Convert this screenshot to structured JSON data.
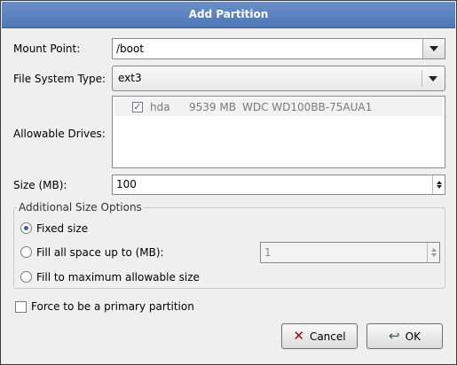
{
  "dialog": {
    "title": "Add Partition"
  },
  "mount_point": {
    "label": "Mount Point:",
    "value": "/boot"
  },
  "fs_type": {
    "label": "File System Type:",
    "value": "ext3"
  },
  "drives": {
    "label": "Allowable Drives:",
    "rows": [
      {
        "checked": true,
        "name": "hda",
        "size": "9539 MB",
        "model": "WDC WD100BB-75AUA1"
      }
    ]
  },
  "size": {
    "label": "Size (MB):",
    "value": "100"
  },
  "additional": {
    "title": "Additional Size Options",
    "fixed_label": "Fixed size",
    "fill_upto_label": "Fill all space up to (MB):",
    "fill_upto_value": "1",
    "fill_max_label": "Fill to maximum allowable size",
    "selected": "fixed"
  },
  "primary": {
    "label": "Force to be a primary partition",
    "checked": false
  },
  "buttons": {
    "cancel": "Cancel",
    "ok": "OK"
  },
  "icons": {
    "cancel": "x-icon",
    "ok": "check-arrow-icon",
    "dropdown": "chevron-down-icon"
  },
  "colors": {
    "title_bar": "#5f84c0",
    "dialog_bg": "#efefef",
    "accent": "#3b5f96"
  }
}
